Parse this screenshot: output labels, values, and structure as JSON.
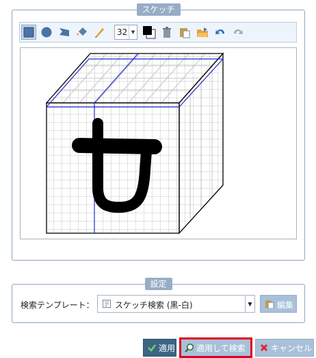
{
  "sketch_panel": {
    "legend": "スケッチ",
    "toolbar": {
      "tools": [
        "rectangle-tool-icon",
        "circle-tool-icon",
        "polygon-tool-icon",
        "fill-bucket-icon",
        "pen-tool-icon"
      ],
      "brush_size": "32",
      "color_icon": "color-picker-icon",
      "actions": [
        "trash-icon",
        "paste-icon",
        "open-folder-icon",
        "undo-icon",
        "redo-icon"
      ]
    }
  },
  "settings_panel": {
    "legend": "設定",
    "template_label": "検索テンプレート：",
    "template_value": "スケッチ検索 (黒-白)",
    "edit_label": "編集"
  },
  "buttons": {
    "apply": "適用",
    "apply_search": "適用して検索",
    "cancel": "キャンセル"
  },
  "colors": {
    "panel_border": "#8fa6bf",
    "legend_bg": "#97adc6",
    "apply_bg": "#3d6483",
    "button_bg": "#a9c0da",
    "highlight": "#e0001a"
  }
}
